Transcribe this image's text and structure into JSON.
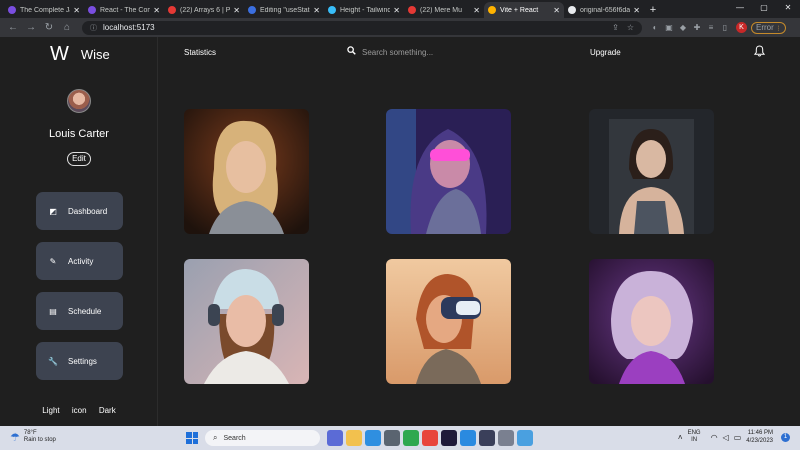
{
  "browser": {
    "tabs": [
      {
        "title": "The Complete Ja",
        "color": "#7a4ee0"
      },
      {
        "title": "React - The Comp",
        "color": "#7a4ee0"
      },
      {
        "title": "(22) Arrays 6 | Pr",
        "color": "#e53935"
      },
      {
        "title": "Editing \"useState",
        "color": "#3b6fe0"
      },
      {
        "title": "Height - Tailwind",
        "color": "#38bdf8"
      },
      {
        "title": "(22) Mere Mu",
        "color": "#e53935"
      },
      {
        "title": "Vite + React",
        "color": "#ffb300"
      },
      {
        "title": "original-656f6da",
        "color": "#e8eaed"
      }
    ],
    "active_tab_index": 6,
    "url": "localhost:5173",
    "profile_initial": "K",
    "error_chip": "Error"
  },
  "app": {
    "logo": "W",
    "name": "Wise",
    "user": {
      "name": "Louis Carter",
      "edit_label": "Edit"
    },
    "nav": [
      {
        "label": "Dashboard",
        "icon": "dashboard-icon",
        "glyph": "◩"
      },
      {
        "label": "Activity",
        "icon": "pencil-square-icon",
        "glyph": "✎"
      },
      {
        "label": "Schedule",
        "icon": "document-icon",
        "glyph": "▤"
      },
      {
        "label": "Settings",
        "icon": "wrench-icon",
        "glyph": "🔧"
      }
    ],
    "theme": {
      "light": "Light",
      "icon": "icon",
      "dark": "Dark"
    },
    "topbar": {
      "statistics": "Statistics",
      "search_placeholder": "Search something...",
      "upgrade": "Upgrade"
    }
  },
  "taskbar": {
    "weather_temp": "78°F",
    "weather_desc": "Rain to stop",
    "search_label": "Search",
    "lang_top": "ENG",
    "lang_bottom": "IN",
    "time": "11:46 PM",
    "date": "4/23/2023",
    "notif_count": "1"
  }
}
